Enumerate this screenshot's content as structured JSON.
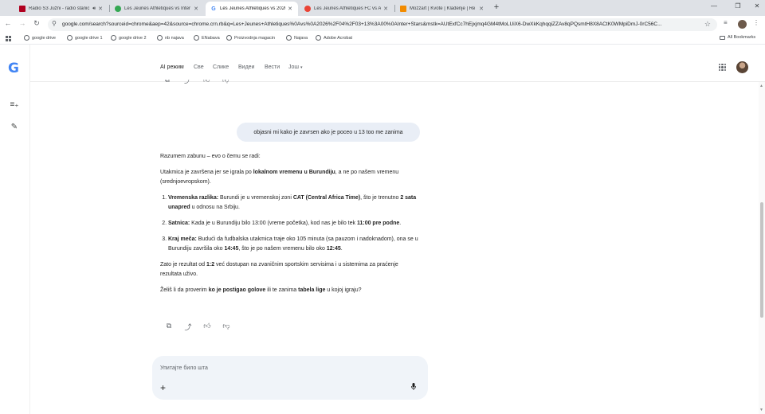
{
  "browser": {
    "tabs": [
      {
        "label": "Radio S3 Južni - radio stanic",
        "favicon_color": "#b00020",
        "audio": true,
        "active": false
      },
      {
        "label": "Les Jeunes Athletiques vs Inter",
        "favicon_color": "#34a853",
        "audio": false,
        "active": false
      },
      {
        "label": "Les Jeunes Athletiques vs 2026",
        "favicon_color": "#4285f4",
        "audio": false,
        "active": true
      },
      {
        "label": "Les Jeunes Athletiques FC vs Al",
        "favicon_color": "#ea4335",
        "audio": false,
        "active": false
      },
      {
        "label": "Mozzart | Kvote | Klađenje | Re",
        "favicon_color": "#f28b00",
        "audio": false,
        "active": false
      }
    ],
    "url": "google.com/search?sourceid=chrome&aep=42&source=chrome.crn.rb&q=Les+Jeunes+Athletiques%0Avs%0A2026%2F04%2F03+13%3A00%0AInter+Stars&mstk=AUtExfCc7hEjxjmq4GM4tMoLUiX6-DwXkKqhqqiZZAv8qPQsmtH8X8ACtK0WMpiDmJ-0rC56C...",
    "bookmarks": [
      "google drive",
      "google drive 1",
      "google drive 2",
      "nb najava",
      "ENabava",
      "Proizvodnja magacin",
      "Najava",
      "Adobe Acrobat"
    ],
    "all_bookmarks": "All Bookmarks"
  },
  "search": {
    "nav_tabs": [
      "AI режим",
      "Све",
      "Слике",
      "Видеи",
      "Вести",
      "Још"
    ],
    "active_tab": "AI режим"
  },
  "conversation": {
    "user_message": "objasni mi kako je zavrsen ako je poceo u 13 too me zanima",
    "answer": {
      "intro": "Razumem zabunu – evo o čemu se radi:",
      "p1_a": "Utakmica je završena jer se igrala po ",
      "p1_b": "lokalnom vremenu u Burundiju",
      "p1_c": ", a ne po našem vremenu (srednjoevropskom).",
      "li1_title": "Vremenska razlika:",
      "li1_a": " Burundi je u vremenskoj zoni ",
      "li1_b": "CAT (Central Africa Time)",
      "li1_c": ", što je trenutno ",
      "li1_d": "2 sata unapred",
      "li1_e": " u odnosu na Srbiju.",
      "li2_title": "Satnica:",
      "li2_a": " Kada je u Burundiju bilo 13:00 (vreme početka), kod nas je bilo tek ",
      "li2_b": "11:00 pre podne",
      "li2_c": ".",
      "li3_title": "Kraj meča:",
      "li3_a": " Budući da fudbalska utakmica traje oko 105 minuta (sa pauzom i nadoknadom), ona se u Burundiju završila oko ",
      "li3_b": "14:45",
      "li3_c": ", što je po našem vremenu bilo oko ",
      "li3_d": "12:45",
      "li3_e": ".",
      "p2_a": "Zato je rezultat od ",
      "p2_b": "1:2",
      "p2_c": " već dostupan na zvaničnim sportskim servisima i u sistemima za praćenje rezultata uživo.",
      "p3_a": "Želiš li da proverim ",
      "p3_b": "ko je postigao golove",
      "p3_c": " ili te zanima ",
      "p3_d": "tabela lige",
      "p3_e": " u kojoj igraju?"
    }
  },
  "composer": {
    "placeholder": "Упитајте било шта"
  },
  "icons": {
    "copy": "copy-icon",
    "share": "share-icon",
    "like": "thumbs-up-icon",
    "dislike": "thumbs-down-icon",
    "new_chat": "new-chat-icon",
    "history": "history-icon",
    "mic": "mic-icon",
    "add": "plus-icon"
  }
}
